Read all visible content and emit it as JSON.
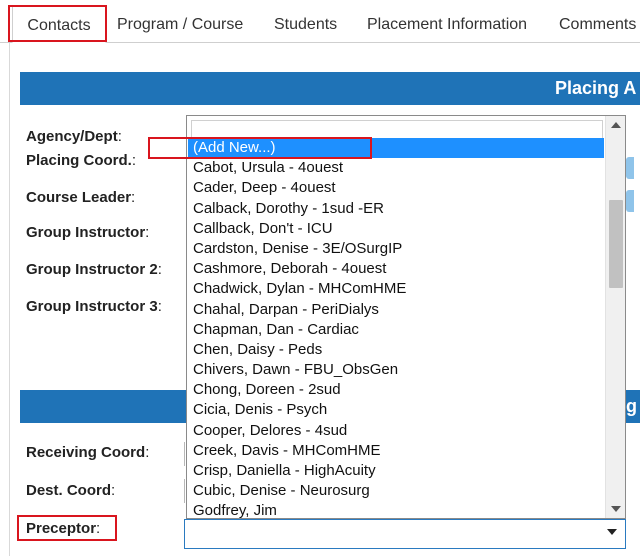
{
  "tabs": [
    {
      "label": "Contacts",
      "active": true
    },
    {
      "label": "Program / Course",
      "active": false
    },
    {
      "label": "Students",
      "active": false
    },
    {
      "label": "Placement Information",
      "active": false
    },
    {
      "label": "Comments",
      "active": false
    }
  ],
  "placing_section": {
    "title": "Placing A"
  },
  "receiving_section": {
    "title": "g A"
  },
  "labels": {
    "agency_dept": "Agency/Dept",
    "placing_coord": "Placing Coord.",
    "course_leader": "Course Leader",
    "group_instructor": "Group Instructor",
    "group_instructor_2": "Group Instructor 2",
    "group_instructor_3": "Group Instructor 3",
    "receiving_coord": "Receiving Coord",
    "dest_coord": "Dest. Coord",
    "preceptor": "Preceptor"
  },
  "dropdown": {
    "search_value": "",
    "options": [
      "(Add New...)",
      "Cabot, Ursula - 4ouest",
      "Cader, Deep - 4ouest",
      "Calback, Dorothy - 1sud -ER",
      "Callback, Don't - ICU",
      "Cardston, Denise - 3E/OSurgIP",
      "Cashmore, Deborah - 4ouest",
      "Chadwick, Dylan - MHComHME",
      "Chahal, Darpan - PeriDialys",
      "Chapman, Dan - Cardiac",
      "Chen, Daisy - Peds",
      "Chivers, Dawn - FBU_ObsGen",
      "Chong, Doreen - 2sud",
      "Cicia, Denis - Psych",
      "Cooper, Delores - 4sud",
      "Creek, Davis - MHComHME",
      "Crisp, Daniella - HighAcuity",
      "Cubic, Denise - Neurosurg",
      "Godfrey, Jim"
    ],
    "highlighted": "(Add New...)"
  },
  "preceptor_select": {
    "value": ""
  },
  "colors": {
    "band": "#1f73b7",
    "highlight": "#1e90ff",
    "annotation": "#d9151e"
  }
}
